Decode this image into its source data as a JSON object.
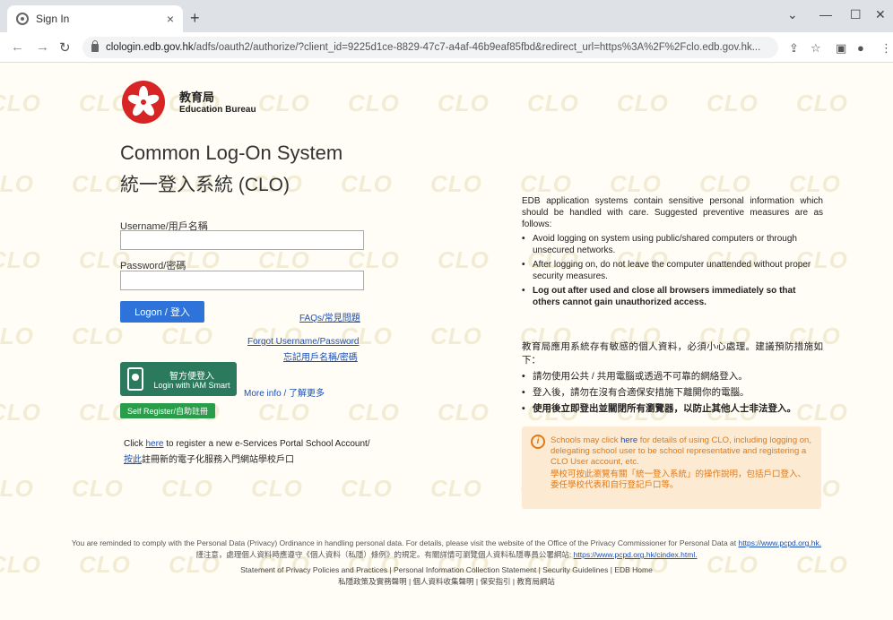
{
  "browser": {
    "tab_title": "Sign In",
    "tab_close": "×",
    "new_tab": "+",
    "url_host": "clologin.edb.gov.hk",
    "url_path": "/adfs/oauth2/authorize/?client_id=9225d1ce-8829-47c7-a4af-46b9eaf85fbd&redirect_url=https%3A%2F%2Fclo.edb.gov.hk...",
    "icons": [
      "back-arrow-icon",
      "forward-arrow-icon",
      "reload-icon",
      "lock-icon",
      "share-icon",
      "star-icon",
      "sidepanel-icon",
      "profile-icon",
      "menu-icon"
    ]
  },
  "watermark": "CLO",
  "org": {
    "name_zh": "教育局",
    "name_en": "Education Bureau",
    "logo_color": "#d72424"
  },
  "system": {
    "title_en": "Common Log-On System",
    "title_zh": "統一登入系統 (CLO)"
  },
  "form": {
    "username_label": "Username/用戶名稱",
    "username_value": "",
    "password_label": "Password/密碼",
    "password_value": "",
    "logon_button": "Logon / 登入",
    "faqs_link": "FAQs/常見問題",
    "forgot_en": "Forgot Username/Password",
    "forgot_zh": "忘記用戶名稱/密碼",
    "iam_title": "智方便登入",
    "iam_subtitle": "Login with iAM Smart",
    "more_info": "More info / 了解更多",
    "self_register": "Self Register/自助註冊",
    "accent_color": "#2e73d9",
    "iam_color": "#2b7a5e",
    "selfreg_color": "#2a9d4a"
  },
  "register": {
    "line1_pre": "Click ",
    "line1_link": "here",
    "line1_post": " to register a new e-Services Portal School Account/",
    "line2_link": "按此",
    "line2_post": "註冊新的電子化服務入門網站學校戶口"
  },
  "notice_en": {
    "intro": "EDB application systems contain sensitive personal information which should be handled with care. Suggested preventive measures are as follows:",
    "items": [
      "Avoid logging on system using public/shared computers or through unsecured networks.",
      "After logging on, do not leave the computer unattended without proper security measures.",
      "Log out after used and close all browsers immediately so that others cannot gain unauthorized access."
    ]
  },
  "notice_zh": {
    "intro": "教育局應用系統存有敏感的個人資料，必須小心處理。建議預防措施如下：",
    "items": [
      "請勿使用公共 / 共用電腦或透過不可靠的網絡登入。",
      "登入後，請勿在沒有合適保安措施下離開你的電腦。",
      "使用後立即登出並關閉所有瀏覽器，以防止其他人士非法登入。"
    ]
  },
  "schools": {
    "en_pre": "Schools may click ",
    "en_link": "here",
    "en_post": " for details of using CLO, including logging on, delegating school user to be school representative and registering a CLO User account, etc.",
    "zh": "學校可按此瀏覽有關「統一登入系統」的操作說明，包括戶口登入、委任學校代表和自行登記戶口等。",
    "color": "#e07a18",
    "bg": "#fcead2"
  },
  "footer": {
    "privacy_en": "You are reminded to comply with the Personal Data (Privacy) Ordinance in handling personal data. For details, please visit the website of the Office of the Privacy Commissioner for Personal Data at ",
    "privacy_en_link": "https://www.pcpd.org.hk.",
    "privacy_zh": "謹注意，處理個人資料時應遵守《個人資料（私隱）條例》的規定。有關詳情可瀏覽個人資料私隱專員公署網站: ",
    "privacy_zh_link": "https://www.pcpd.org.hk/cindex.html.",
    "links_en": "Statement of Privacy Policies and Practices  |  Personal Information Collection Statement  |  Security Guidelines  |  EDB Home",
    "links_zh": "私隱政策及實務聲明  |  個人資料收集聲明  |  保安指引  |  教育局網站"
  }
}
